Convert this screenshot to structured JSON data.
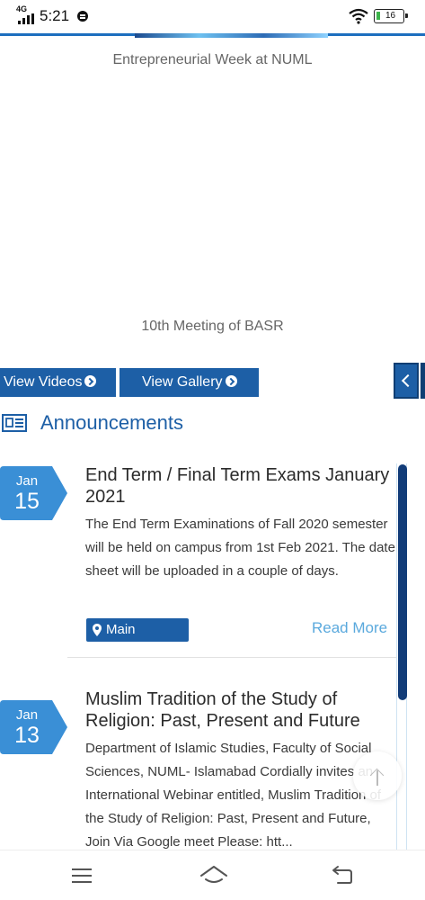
{
  "status_bar": {
    "network": "4G",
    "time": "5:21",
    "battery": "16"
  },
  "carousel": {
    "caption_1": "Entrepreneurial Week at NUML",
    "caption_2": "10th Meeting of BASR"
  },
  "media_buttons": {
    "videos": "View Videos",
    "gallery": "View Gallery"
  },
  "announcements": {
    "heading": "Announcements",
    "items": [
      {
        "month": "Jan",
        "day": "15",
        "title": "End Term / Final Term Exams January 2021",
        "text": "The End Term Examinations of Fall 2020 semester will be held on campus from 1st Feb 2021. The date sheet will be uploaded in a couple of days.",
        "campus": "Main Campus",
        "read_more": "Read More"
      },
      {
        "month": "Jan",
        "day": "13",
        "title": "Muslim Tradition of the Study of Religion: Past, Present and Future",
        "text": "Department of Islamic Studies, Faculty of Social Sciences, NUML- Islamabad Cordially invites an International Webinar entitled, Muslim Tradition of the Study of Religion: Past, Present and Future, Join Via Google meet Please: htt..."
      }
    ]
  },
  "colors": {
    "primary": "#1d5fa6",
    "badge": "#3a8fd6",
    "link": "#5aa9dd",
    "scroll_thumb": "#123c78"
  }
}
